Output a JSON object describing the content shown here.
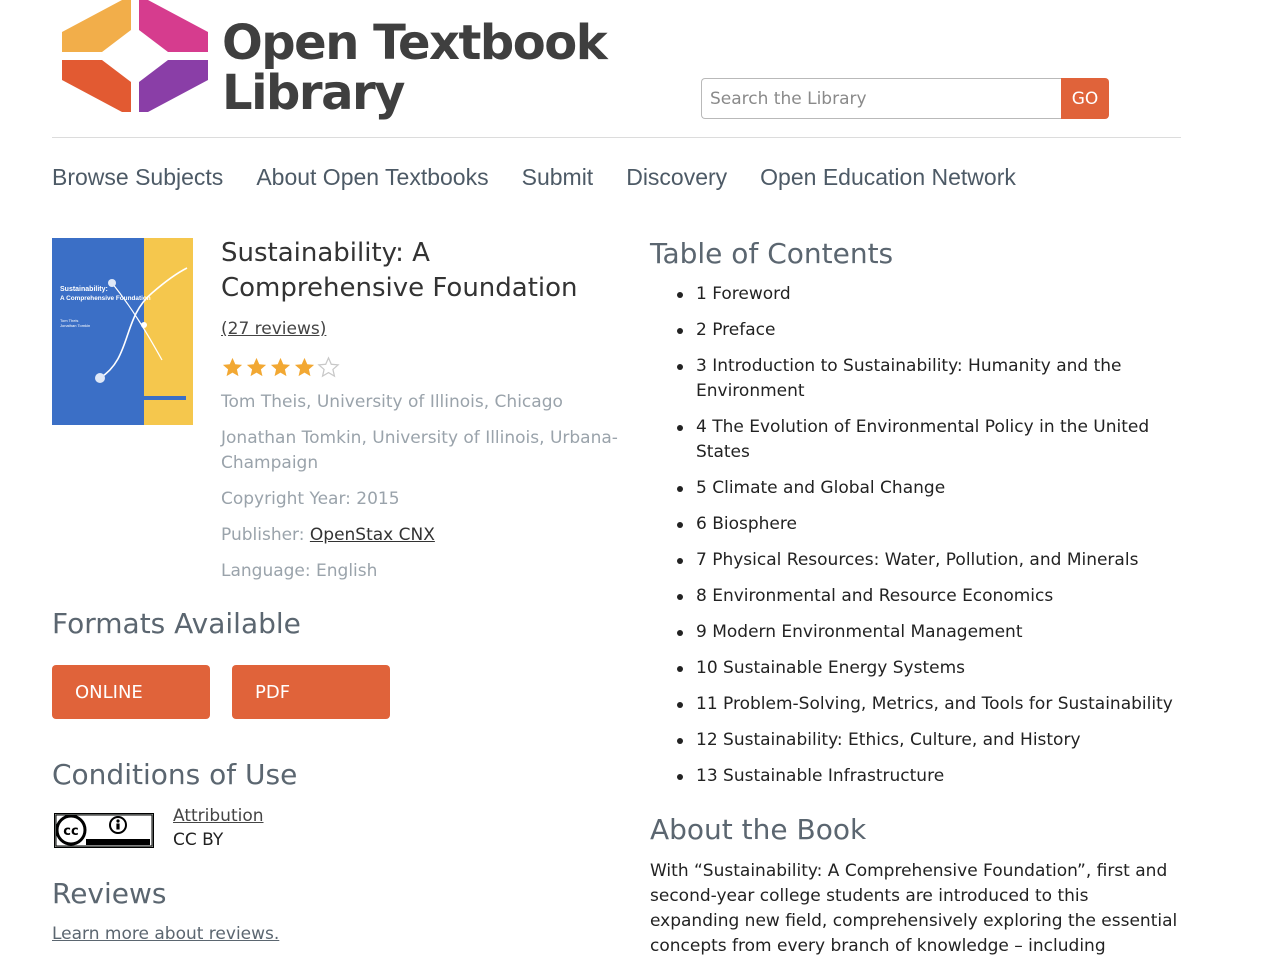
{
  "header": {
    "brand_line1": "Open Textbook",
    "brand_line2": "Library",
    "search_placeholder": "Search the Library",
    "search_button": "GO"
  },
  "nav": {
    "items": [
      {
        "label": "Browse Subjects"
      },
      {
        "label": "About Open Textbooks"
      },
      {
        "label": "Submit"
      },
      {
        "label": "Discovery"
      },
      {
        "label": "Open Education Network"
      }
    ]
  },
  "book": {
    "title": "Sustainability: A Comprehensive Foundation",
    "reviews_link": "(27 reviews)",
    "rating": 4,
    "rating_max": 5,
    "authors": [
      "Tom Theis, University of Illinois, Chicago",
      "Jonathan Tomkin, University of Illinois, Urbana-Champaign"
    ],
    "copyright_label": "Copyright Year: 2015",
    "publisher_label": "Publisher: ",
    "publisher_name": "OpenStax CNX",
    "language_label": "Language: English",
    "cover": {
      "title_line1": "Sustainability:",
      "title_line2": "A Comprehensive Foundation",
      "author_line1": "Tom Theis",
      "author_line2": "Jonathan Tomkin",
      "colors": {
        "left": "#3b6fc6",
        "right": "#f5c74d",
        "bar": "#3b6fc6"
      }
    }
  },
  "formats": {
    "heading": "Formats Available",
    "buttons": [
      {
        "label": "ONLINE"
      },
      {
        "label": "PDF"
      }
    ]
  },
  "conditions": {
    "heading": "Conditions of Use",
    "license_link": "Attribution",
    "license_code": "CC BY",
    "badge_icon": "cc-by-icon"
  },
  "reviews": {
    "heading": "Reviews",
    "learn_more": "Learn more about reviews."
  },
  "toc": {
    "heading": "Table of Contents",
    "items": [
      "1 Foreword",
      "2 Preface",
      "3 Introduction to Sustainability: Humanity and the Environment",
      "4 The Evolution of Environmental Policy in the United States",
      "5 Climate and Global Change",
      "6 Biosphere",
      "7 Physical Resources: Water, Pollution, and Minerals",
      "8 Environmental and Resource Economics",
      "9 Modern Environmental Management",
      "10 Sustainable Energy Systems",
      "11 Problem-Solving, Metrics, and Tools for Sustainability",
      "12 Sustainability: Ethics, Culture, and History",
      "13 Sustainable Infrastructure"
    ]
  },
  "about": {
    "heading": "About the Book",
    "text": "With “Sustainability: A Comprehensive Foundation”, first and second-year college students are introduced to this expanding new field, comprehensively exploring the essential concepts from every branch of knowledge – including engineering and the"
  },
  "colors": {
    "accent": "#e0633a",
    "heading": "#5b6670",
    "muted": "#9aa3ab",
    "star": "#f2a833"
  }
}
